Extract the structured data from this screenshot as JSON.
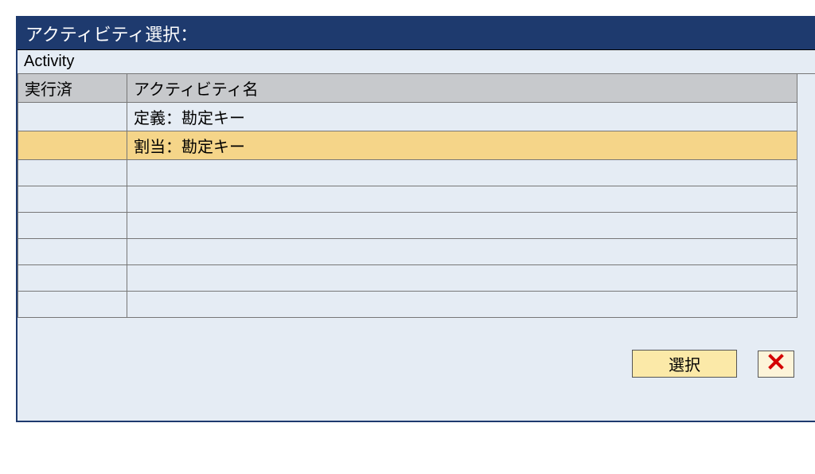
{
  "window": {
    "title": "アクティビティ選択："
  },
  "group": {
    "label": "Activity"
  },
  "table": {
    "headers": {
      "executed": "実行済",
      "activity_name": "アクティビティ名"
    },
    "rows": [
      {
        "executed": "",
        "name": "定義：勘定キー",
        "selected": false
      },
      {
        "executed": "",
        "name": "割当：勘定キー",
        "selected": true
      },
      {
        "executed": "",
        "name": "",
        "selected": false
      },
      {
        "executed": "",
        "name": "",
        "selected": false
      },
      {
        "executed": "",
        "name": "",
        "selected": false
      },
      {
        "executed": "",
        "name": "",
        "selected": false
      },
      {
        "executed": "",
        "name": "",
        "selected": false
      },
      {
        "executed": "",
        "name": "",
        "selected": false
      }
    ]
  },
  "footer": {
    "select_label": "選択"
  }
}
